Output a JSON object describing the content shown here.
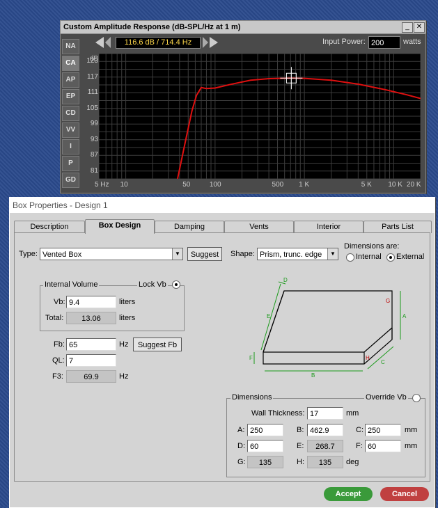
{
  "amp_window": {
    "title": "Custom Amplitude Response (dB-SPL/Hz at 1 m)",
    "minimize": "_",
    "close": "✕",
    "readout": "116.6 dB / 714.4 Hz",
    "input_power_label": "Input Power:",
    "input_power_value": "200",
    "input_power_unit": "watts",
    "side_tabs": [
      "NA",
      "CA",
      "AP",
      "EP",
      "CD",
      "VV",
      "I",
      "P",
      "GD"
    ],
    "active_side_tab": "CA",
    "y_unit": "dB",
    "y_ticks": [
      "123",
      "117",
      "111",
      "105",
      "99",
      "93",
      "87",
      "81"
    ],
    "x_ticks": [
      "5 Hz",
      "10",
      "50",
      "100",
      "500",
      "1 K",
      "5 K",
      "10 K",
      "20 K"
    ],
    "curve_color": "#e01010"
  },
  "chart_data": {
    "type": "line",
    "xlabel": "",
    "ylabel": "dB",
    "xscale": "log",
    "xlim": [
      5,
      20000
    ],
    "ylim": [
      78,
      126
    ],
    "series": [
      {
        "x": [
          38,
          45,
          55,
          62,
          70,
          80,
          100,
          150,
          250,
          400,
          714.4,
          1000,
          2000,
          4000,
          8000,
          14000,
          20000
        ],
        "values": [
          78,
          90,
          104,
          110,
          113,
          112.6,
          112.8,
          114.2,
          115.8,
          116.4,
          116.6,
          116.5,
          115.8,
          114.3,
          112.2,
          110.2,
          108.8
        ]
      }
    ],
    "cursor": {
      "x": 714.4,
      "y": 116.6
    }
  },
  "box_window": {
    "title": "Box Properties - Design 1",
    "tabs": [
      "Description",
      "Box Design",
      "Damping",
      "Vents",
      "Interior",
      "Parts List"
    ],
    "active_tab": "Box Design",
    "type_label": "Type:",
    "type_value": "Vented Box",
    "suggest": "Suggest",
    "shape_label": "Shape:",
    "shape_value": "Prism, trunc. edge",
    "dims_are_label": "Dimensions are:",
    "internal": "Internal",
    "external": "External",
    "internal_volume": "Internal Volume",
    "lock_vb": "Lock Vb",
    "vb_label": "Vb:",
    "vb_value": "9.4",
    "liters": "liters",
    "total_label": "Total:",
    "total_value": "13.06",
    "fb_label": "Fb:",
    "fb_value": "65",
    "hz": "Hz",
    "suggest_fb": "Suggest Fb",
    "ql_label": "QL:",
    "ql_value": "7",
    "f3_label": "F3:",
    "f3_value": "69.9",
    "dimensions": "Dimensions",
    "override_vb": "Override Vb",
    "wall_label": "Wall Thickness:",
    "wall_value": "17",
    "mm": "mm",
    "deg": "deg",
    "a_label": "A:",
    "a_value": "250",
    "b_label": "B:",
    "b_value": "462.9",
    "c_label": "C:",
    "c_value": "250",
    "d_label": "D:",
    "d_value": "60",
    "e_label": "E:",
    "e_value": "268.7",
    "f_label": "F:",
    "f_value": "60",
    "g_label": "G:",
    "g_value": "135",
    "h_label": "H:",
    "h_value": "135",
    "diagram_labels": {
      "A": "A",
      "B": "B",
      "C": "C",
      "D": "D",
      "E": "E",
      "F": "F",
      "G": "G",
      "H": "H"
    },
    "accept": "Accept",
    "cancel": "Cancel",
    "accept_color": "#3a9a3a",
    "cancel_color": "#c04040"
  }
}
